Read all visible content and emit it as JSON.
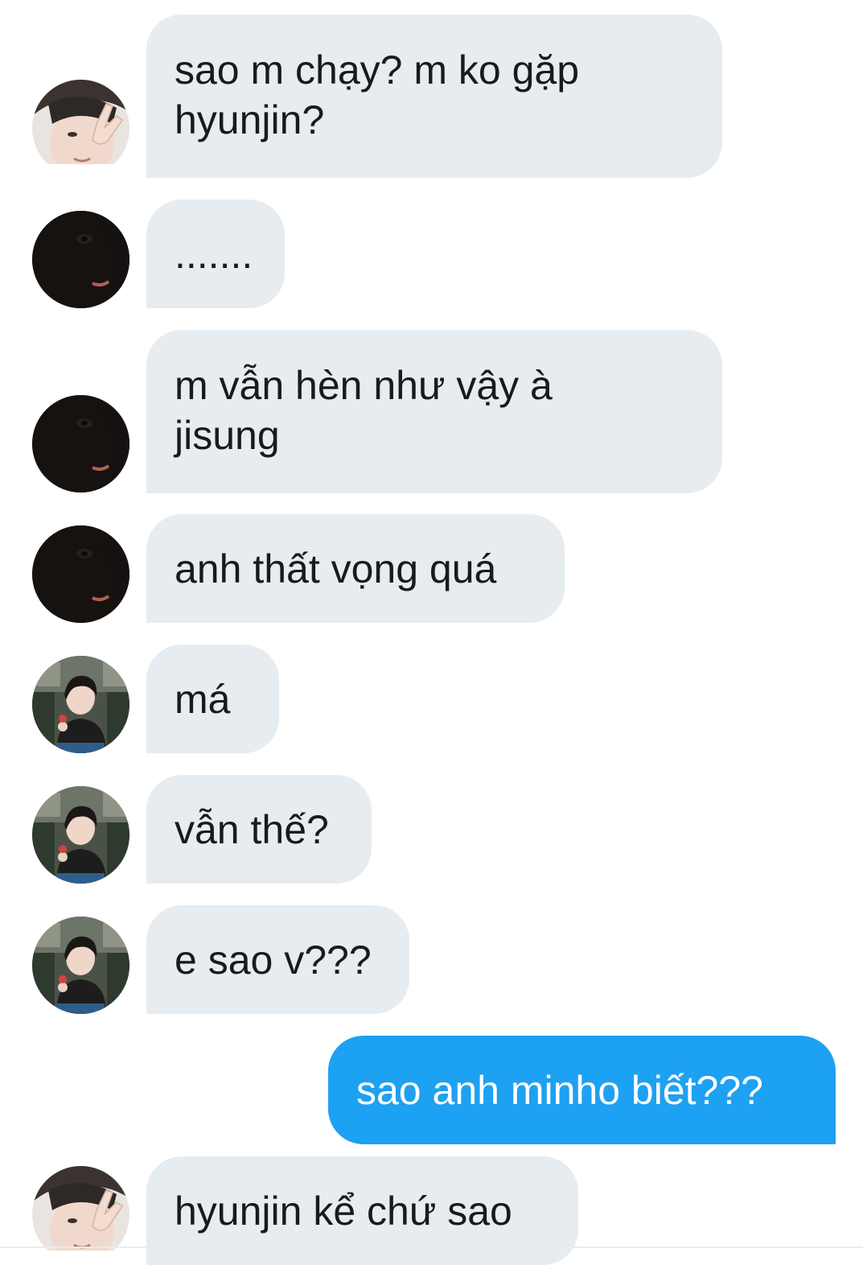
{
  "messages": [
    {
      "sender": "other",
      "avatar": "avatar-peace-sign",
      "text": "sao m chạy? m ko gặp\nhyunjin?"
    },
    {
      "sender": "other",
      "avatar": "avatar-dark-hood",
      "text": "......."
    },
    {
      "sender": "other",
      "avatar": "avatar-dark-hood",
      "text": "m vẫn hèn như vậy à\njisung"
    },
    {
      "sender": "other",
      "avatar": "avatar-dark-hood",
      "text": "anh thất vọng quá"
    },
    {
      "sender": "other",
      "avatar": "avatar-train-seat",
      "text": "má"
    },
    {
      "sender": "other",
      "avatar": "avatar-train-seat",
      "text": "vẫn thế?"
    },
    {
      "sender": "other",
      "avatar": "avatar-train-seat",
      "text": "e sao v???"
    },
    {
      "sender": "self",
      "avatar": "",
      "text": "sao anh minho biết???"
    },
    {
      "sender": "other",
      "avatar": "avatar-peace-sign",
      "text": "hyunjin kể chứ sao"
    }
  ],
  "colors": {
    "received_bubble": "#e6ecf0",
    "sent_bubble": "#1da1f2",
    "received_text": "#1a1a1a",
    "sent_text": "#ffffff"
  }
}
